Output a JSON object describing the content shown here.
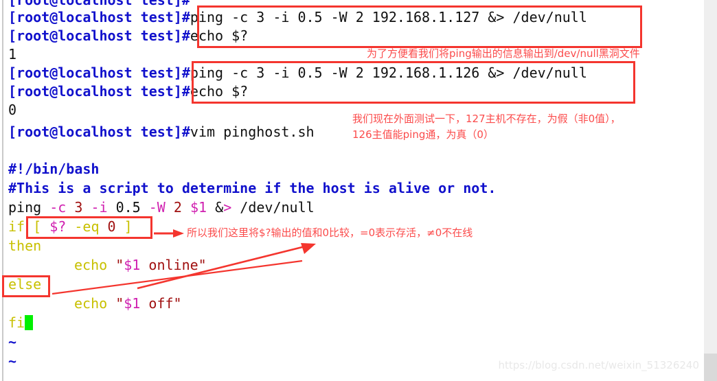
{
  "terminal": {
    "prompt": "[root@localhost test]#",
    "lines": [
      {
        "id": "line-0-partial",
        "prompt": "[root@localhost test]#",
        "command": "",
        "kind": "prompt"
      },
      {
        "id": "line-ping-127",
        "prompt": "[root@localhost test]#",
        "command": "ping -c 3 -i 0.5 -W 2 192.168.1.127 &> /dev/null",
        "kind": "prompt"
      },
      {
        "id": "line-echo-1",
        "prompt": "[root@localhost test]#",
        "command": "echo $?",
        "kind": "prompt"
      },
      {
        "id": "line-output-1",
        "prompt": "",
        "command": "1",
        "kind": "output"
      },
      {
        "id": "line-ping-126",
        "prompt": "[root@localhost test]#",
        "command": "ping -c 3 -i 0.5 -W 2 192.168.1.126 &> /dev/null",
        "kind": "prompt"
      },
      {
        "id": "line-echo-2",
        "prompt": "[root@localhost test]#",
        "command": "echo $?",
        "kind": "prompt"
      },
      {
        "id": "line-output-0",
        "prompt": "",
        "command": "0",
        "kind": "output"
      },
      {
        "id": "line-vim",
        "prompt": "[root@localhost test]#",
        "command": "vim pinghost.sh",
        "kind": "prompt"
      }
    ]
  },
  "editor": {
    "filename": "pinghost.sh",
    "script": {
      "shebang": "#!/bin/bash",
      "comment": "#This is a script to determine if the host is alive or not.",
      "ping_cmd": "ping -c 3 -i 0.5 -W 2 $1 &> /dev/null",
      "ping_parts": {
        "ping": "ping",
        "opt_c": "-c",
        "num_3": "3",
        "opt_i": "-i",
        "num_05": "0.5",
        "opt_W": "-W",
        "num_2": "2",
        "var_1": "$1",
        "amp": "&",
        "gt": ">",
        "devnull": "/dev/null"
      },
      "if_line": {
        "kw_if": "if",
        "bracket_open": "[",
        "var_status": "$?",
        "op_eq": "-eq",
        "num_zero": "0",
        "bracket_close": "]"
      },
      "kw_then": "then",
      "echo_online": {
        "kw_echo": "echo",
        "quote": "\"",
        "var": "$1",
        "text": " online"
      },
      "kw_else": "else",
      "echo_off": {
        "kw_echo": "echo",
        "quote": "\"",
        "var": "$1",
        "text": " off"
      },
      "kw_fi": "fi",
      "tilde": "~"
    }
  },
  "annotations": [
    {
      "id": "note-devnull",
      "text": "为了方便看我们将ping输出的信息输出到/dev/null黑洞文件"
    },
    {
      "id": "note-hosts-line1",
      "text": "我们现在外面测试一下，127主机不存在，为假（非0值），"
    },
    {
      "id": "note-hosts-line2",
      "text": "126主值能ping通，为真（0）"
    },
    {
      "id": "note-compare",
      "text": "所以我们这里将$?输出的值和0比较，=0表示存活，≠0不在线"
    }
  ],
  "watermark": "https://blog.csdn.net/weixin_51326240",
  "colors": {
    "annotation_red": "#fb4b4b",
    "box_red": "#f4352e",
    "prompt_blue": "#1111cc",
    "keyword_olive": "#c8c000",
    "variable_magenta": "#d020b0",
    "string_darkred": "#a01010",
    "cursor_green": "#00f000"
  }
}
